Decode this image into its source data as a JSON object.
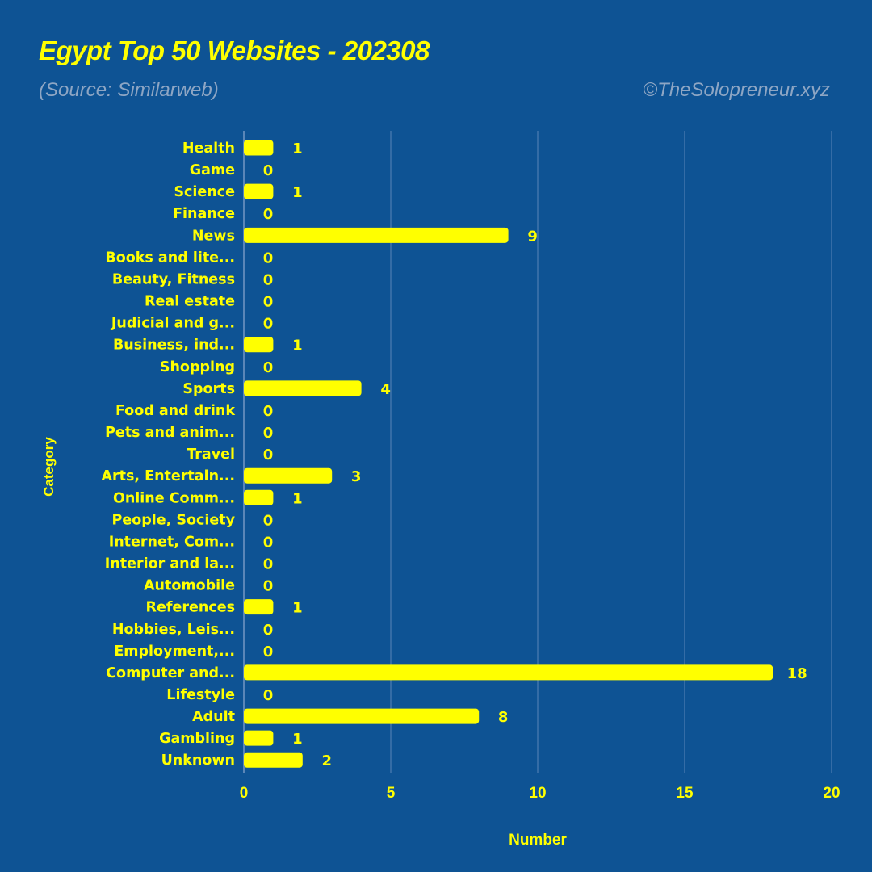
{
  "header": {
    "title": "Egypt Top 50 Websites - 202308",
    "subtitle": "(Source: Similarweb)",
    "credit": "©TheSolopreneur.xyz"
  },
  "colors": {
    "background": "#0e5394",
    "bar": "#ffff00",
    "text": "#ffff00",
    "muted_text": "#8ea6c4",
    "grid": "#5a86b8"
  },
  "chart_data": {
    "type": "bar",
    "orientation": "horizontal",
    "title": "Egypt Top 50 Websites - 202308",
    "subtitle": "(Source: Similarweb)",
    "xlabel": "Number",
    "ylabel": "Category",
    "xlim": [
      0,
      20
    ],
    "xticks": [
      0,
      5,
      10,
      15,
      20
    ],
    "grid": true,
    "categories": [
      "Health",
      "Game",
      "Science",
      "Finance",
      "News",
      "Books and lite...",
      "Beauty, Fitness",
      "Real estate",
      "Judicial and g...",
      "Business, ind...",
      "Shopping",
      "Sports",
      "Food and drink",
      "Pets and anim...",
      "Travel",
      "Arts, Entertain...",
      "Online Comm...",
      "People, Society",
      "Internet, Com...",
      "Interior and la...",
      "Automobile",
      "References",
      "Hobbies, Leis...",
      "Employment,...",
      "Computer and...",
      "Lifestyle",
      "Adult",
      "Gambling",
      "Unknown"
    ],
    "values": [
      1,
      0,
      1,
      0,
      9,
      0,
      0,
      0,
      0,
      1,
      0,
      4,
      0,
      0,
      0,
      3,
      1,
      0,
      0,
      0,
      0,
      1,
      0,
      0,
      18,
      0,
      8,
      1,
      2
    ]
  }
}
